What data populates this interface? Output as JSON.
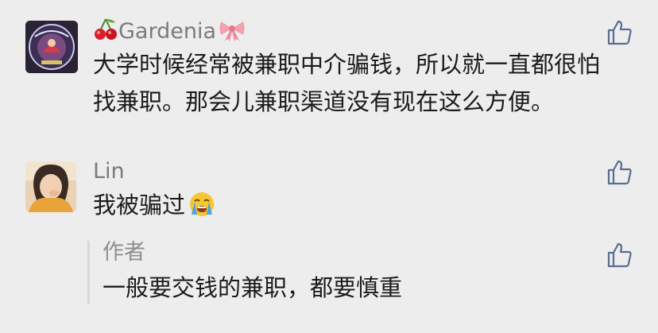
{
  "comments": [
    {
      "name": "Gardenia",
      "name_prefix_icon": "cherry-emoji",
      "name_suffix_icon": "ribbon-emoji",
      "text_lines": [
        "大学时候经常被兼职中介骗钱，所以就一直都很怕",
        "找兼职。那会儿兼职渠道没有现在这么方便。"
      ],
      "like_icon": "thumbs-up-icon"
    },
    {
      "name": "Lin",
      "text": "我被骗过",
      "text_suffix_icon": "crying-face-emoji",
      "like_icon": "thumbs-up-icon",
      "reply": {
        "author": "作者",
        "text": "一般要交钱的兼职，都要慎重",
        "like_icon": "thumbs-up-icon"
      }
    }
  ],
  "colors": {
    "background": "#ededed",
    "name": "#7b7b7b",
    "text": "#1b1b1b",
    "reply_author": "#8e8e8e",
    "reply_bar": "#d8d8d8",
    "icon": "#5a6d92"
  }
}
